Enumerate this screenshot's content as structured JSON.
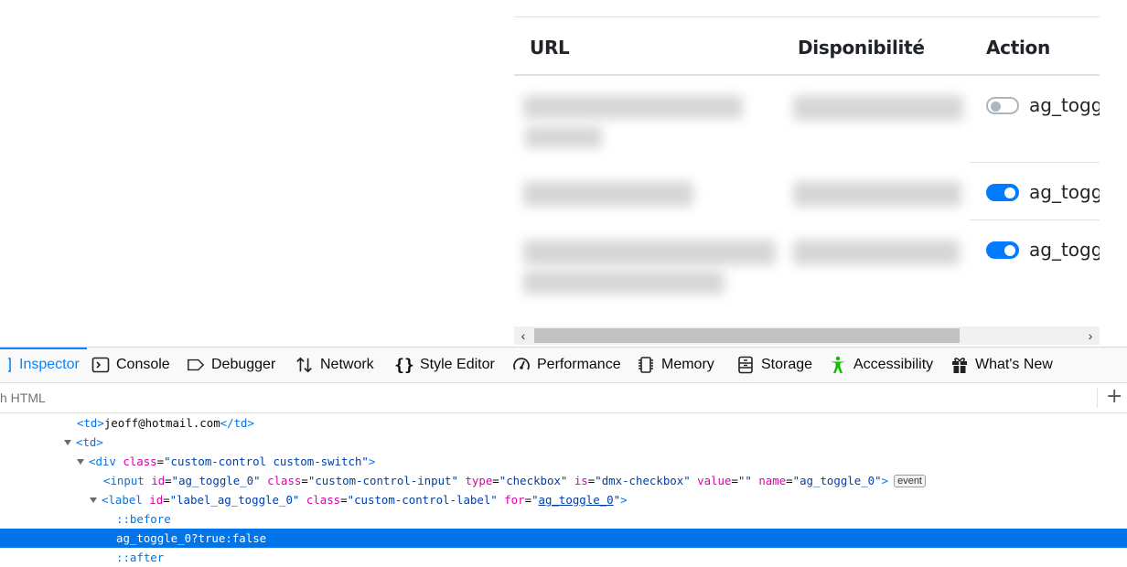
{
  "table": {
    "headers": [
      "URL",
      "Disponibilité",
      "Action"
    ],
    "rows": [
      {
        "toggle_label": "ag_togg",
        "toggle_state": "off"
      },
      {
        "toggle_label": "ag_togg",
        "toggle_state": "on"
      },
      {
        "toggle_label": "ag_togg",
        "toggle_state": "on"
      }
    ]
  },
  "scrollbar": {
    "left_arrow": "‹",
    "right_arrow": "›"
  },
  "devtools": {
    "tabs": [
      {
        "label": "Inspector",
        "icon": "inspector-icon",
        "selected": true
      },
      {
        "label": "Console",
        "icon": "console-icon"
      },
      {
        "label": "Debugger",
        "icon": "debugger-icon"
      },
      {
        "label": "Network",
        "icon": "network-icon"
      },
      {
        "label": "Style Editor",
        "icon": "style-editor-icon"
      },
      {
        "label": "Performance",
        "icon": "performance-icon"
      },
      {
        "label": "Memory",
        "icon": "memory-icon"
      },
      {
        "label": "Storage",
        "icon": "storage-icon"
      },
      {
        "label": "Accessibility",
        "icon": "accessibility-icon"
      },
      {
        "label": "What's New",
        "icon": "gift-icon"
      }
    ],
    "search_placeholder": "h HTML",
    "add_icon": "+",
    "html_lines": {
      "td_email": {
        "open": "<td>",
        "text": "jeoff@hotmail.com",
        "close": "</td>"
      },
      "td_open": "<td>",
      "div": {
        "tag": "<div",
        "attr": "class",
        "value": "\"custom-control custom-switch\"",
        "end": ">"
      },
      "input": {
        "tag": "<input",
        "id_attr": "id",
        "id_val": "\"ag_toggle_0\"",
        "class_attr": "class",
        "class_val": "\"custom-control-input\"",
        "type_attr": "type",
        "type_val": "\"checkbox\"",
        "is_attr": "is",
        "is_val": "\"dmx-checkbox\"",
        "value_attr": "value",
        "value_val": "\"\"",
        "name_attr": "name",
        "name_val": "\"ag_toggle_0\"",
        "end": ">",
        "badge": "event"
      },
      "label": {
        "tag": "<label",
        "id_attr": "id",
        "id_val": "\"label_ag_toggle_0\"",
        "class_attr": "class",
        "class_val": "\"custom-control-label\"",
        "for_attr": "for",
        "for_q1": "\"",
        "for_val": "ag_toggle_0",
        "for_q2": "\"",
        "end": ">"
      },
      "before": "::before",
      "selected_text": "ag_toggle_0?true:false",
      "after": "::after"
    }
  },
  "colors": {
    "accent": "#0a84ff",
    "switch_on": "#007bff",
    "selection": "#0074e8"
  }
}
